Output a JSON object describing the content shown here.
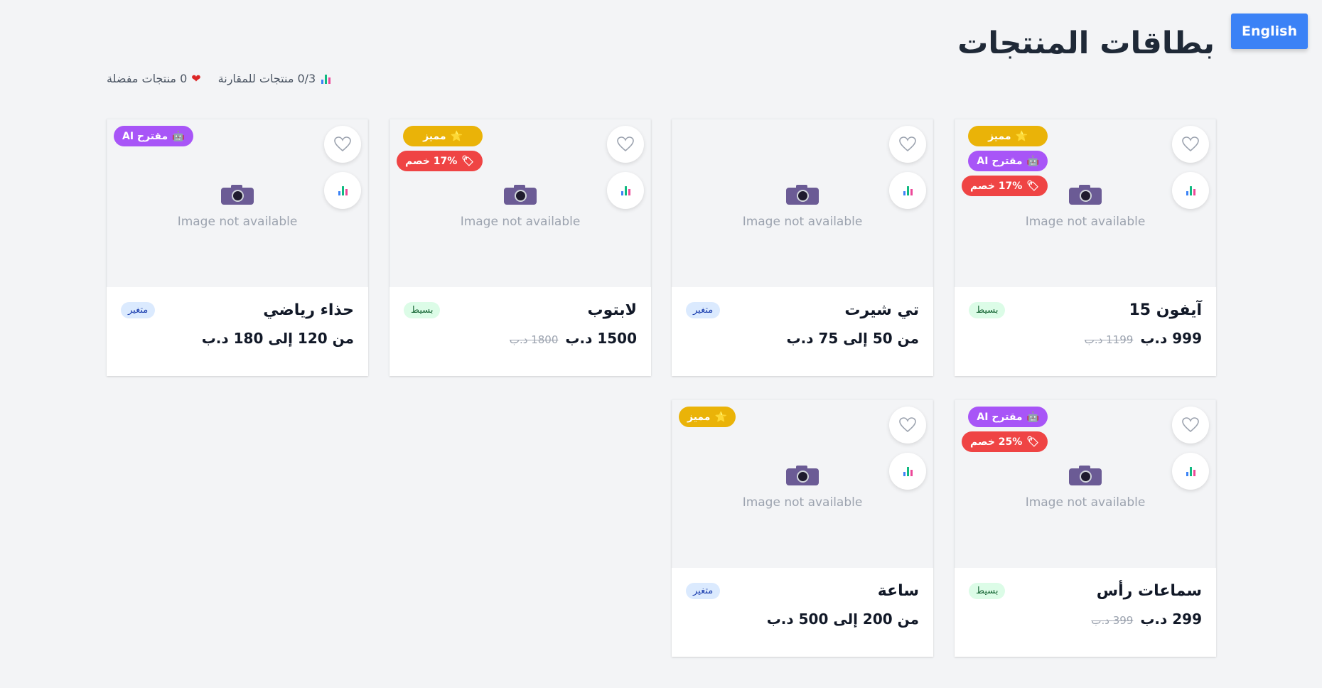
{
  "header": {
    "title": "بطاقات المنتجات",
    "language_button": "English"
  },
  "stats": {
    "compare": "0/3 منتجات للمقارنة",
    "favorites": "0 منتجات مفضلة"
  },
  "placeholder_text": "Image not available",
  "badge_labels": {
    "featured": "مميز",
    "ai": "مقترح AI"
  },
  "colors": {
    "accent": "#3b82f6",
    "featured": "#eab308",
    "ai": "#a855f7",
    "discount": "#ef4444",
    "simple_bg": "#dcfce7",
    "variable_bg": "#dbeafe"
  },
  "icons": {
    "compare": "bar-chart-icon",
    "favorite": "heart-icon",
    "camera": "camera-icon",
    "featured": "star-icon",
    "ai": "robot-icon",
    "discount": "tag-icon"
  },
  "products": [
    {
      "name": "آيفون 15",
      "type": "بسيط",
      "price": "999 د.ب",
      "old_price": "1199 د.ب",
      "badges": {
        "featured": "مميز",
        "ai": "مقترح AI",
        "discount": "17% خصم"
      }
    },
    {
      "name": "تي شيرت",
      "type": "متغير",
      "price": "من 50 إلى 75 د.ب"
    },
    {
      "name": "لابتوب",
      "type": "بسيط",
      "price": "1500 د.ب",
      "old_price": "1800 د.ب",
      "badges": {
        "featured": "مميز",
        "discount": "17% خصم"
      }
    },
    {
      "name": "حذاء رياضي",
      "type": "متغير",
      "price": "من 120 إلى 180 د.ب",
      "badges": {
        "ai": "مقترح AI"
      }
    },
    {
      "name": "سماعات رأس",
      "type": "بسيط",
      "price": "299 د.ب",
      "old_price": "399 د.ب",
      "badges": {
        "ai": "مقترح AI",
        "discount": "25% خصم"
      }
    },
    {
      "name": "ساعة",
      "type": "متغير",
      "price": "من 200 إلى 500 د.ب",
      "badges": {
        "featured": "مميز"
      }
    }
  ]
}
